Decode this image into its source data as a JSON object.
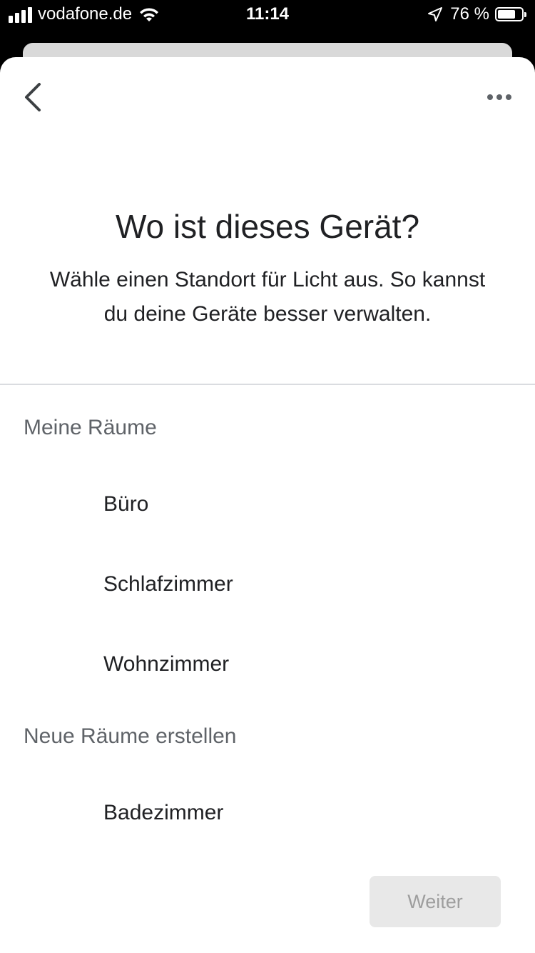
{
  "status_bar": {
    "carrier": "vodafone.de",
    "time": "11:14",
    "battery_percent": "76 %",
    "battery_level": 0.76
  },
  "header": {
    "back_icon": "chevron-left-icon",
    "more_icon": "more-horiz-icon"
  },
  "main": {
    "title": "Wo ist dieses Gerät?",
    "subtitle": "Wähle einen Standort für Licht aus. So kannst du deine Geräte besser verwalten."
  },
  "sections": [
    {
      "label": "Meine Räume",
      "rooms": [
        "Büro",
        "Schlafzimmer",
        "Wohnzimmer"
      ]
    },
    {
      "label": "Neue Räume erstellen",
      "rooms": [
        "Badezimmer"
      ]
    }
  ],
  "footer": {
    "next_label": "Weiter"
  }
}
